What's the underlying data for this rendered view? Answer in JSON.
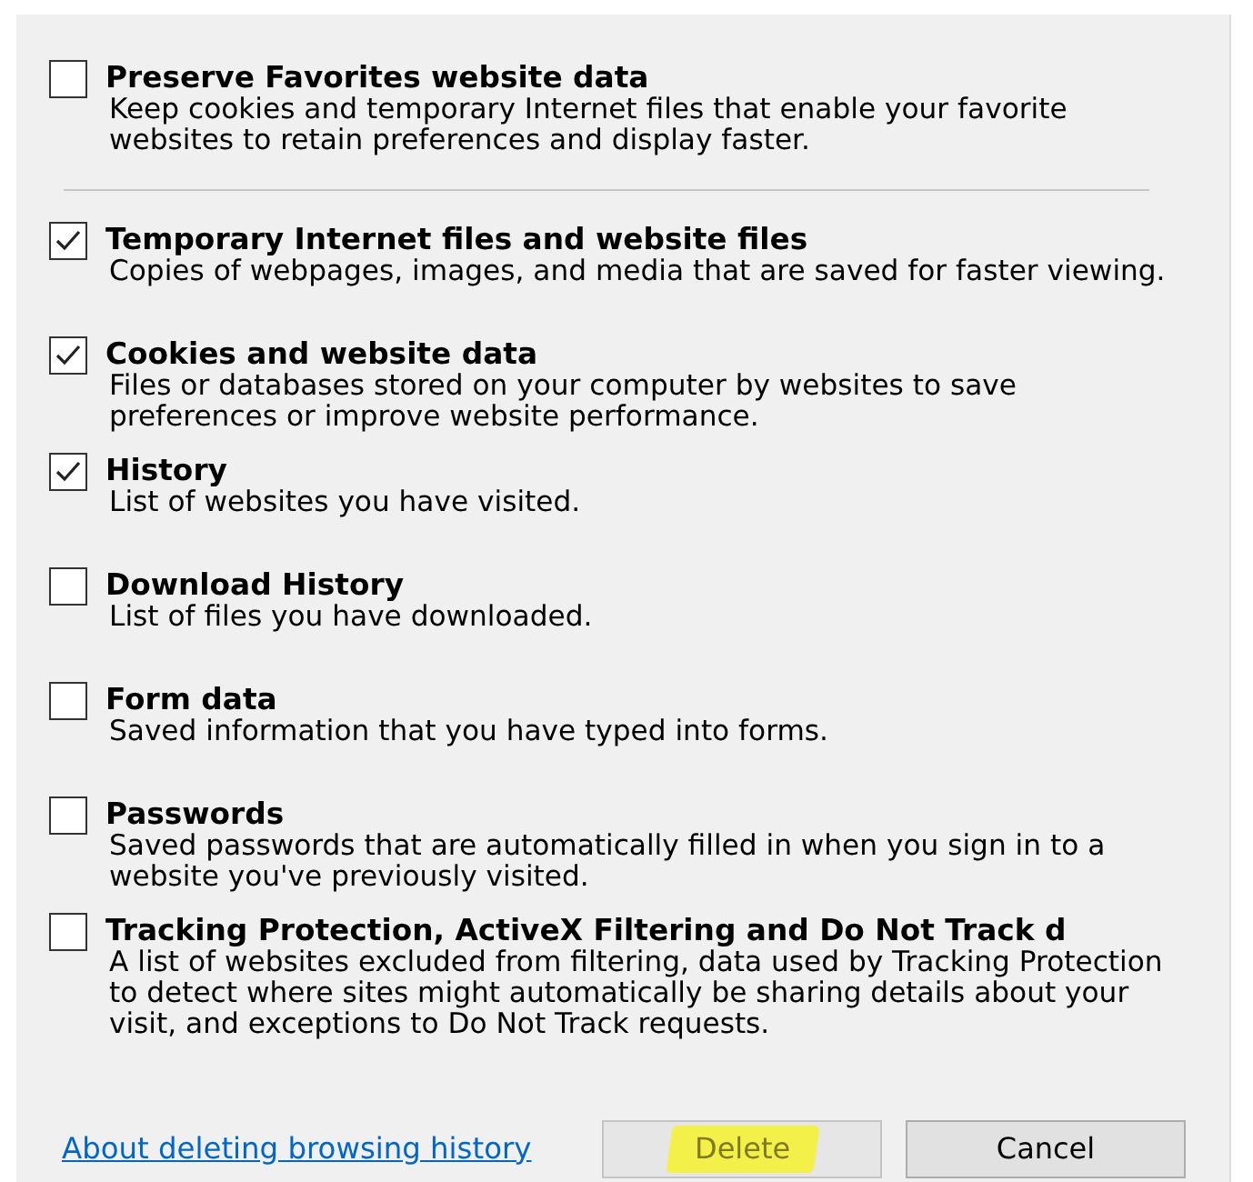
{
  "top_option": {
    "label": "Preserve Favorites website data",
    "description": "Keep cookies and temporary Internet files that enable your favorite websites to retain preferences and display faster.",
    "checked": false
  },
  "options": [
    {
      "label": "Temporary Internet files and website files",
      "description": "Copies of webpages, images, and media that are saved for faster viewing.",
      "checked": true
    },
    {
      "label": "Cookies and website data",
      "description": "Files or databases stored on your computer by websites to save preferences or improve website performance.",
      "checked": true
    },
    {
      "label": "History",
      "description": "List of websites you have visited.",
      "checked": true
    },
    {
      "label": "Download History",
      "description": "List of files you have downloaded.",
      "checked": false
    },
    {
      "label": "Form data",
      "description": "Saved information that you have typed into forms.",
      "checked": false
    },
    {
      "label": "Passwords",
      "description": "Saved passwords that are automatically filled in when you sign in to a website you've previously visited.",
      "checked": false
    },
    {
      "label": "Tracking Protection, ActiveX Filtering and Do Not Track d",
      "description": "A list of websites excluded from filtering, data used by Tracking Protection to detect where sites might automatically be sharing details about your visit, and exceptions to Do Not Track requests.",
      "checked": false
    }
  ],
  "help_link": "About deleting browsing history",
  "buttons": [
    {
      "label": "Delete",
      "disabled": true,
      "highlighted": true
    },
    {
      "label": "Cancel",
      "disabled": false,
      "highlighted": false
    }
  ]
}
